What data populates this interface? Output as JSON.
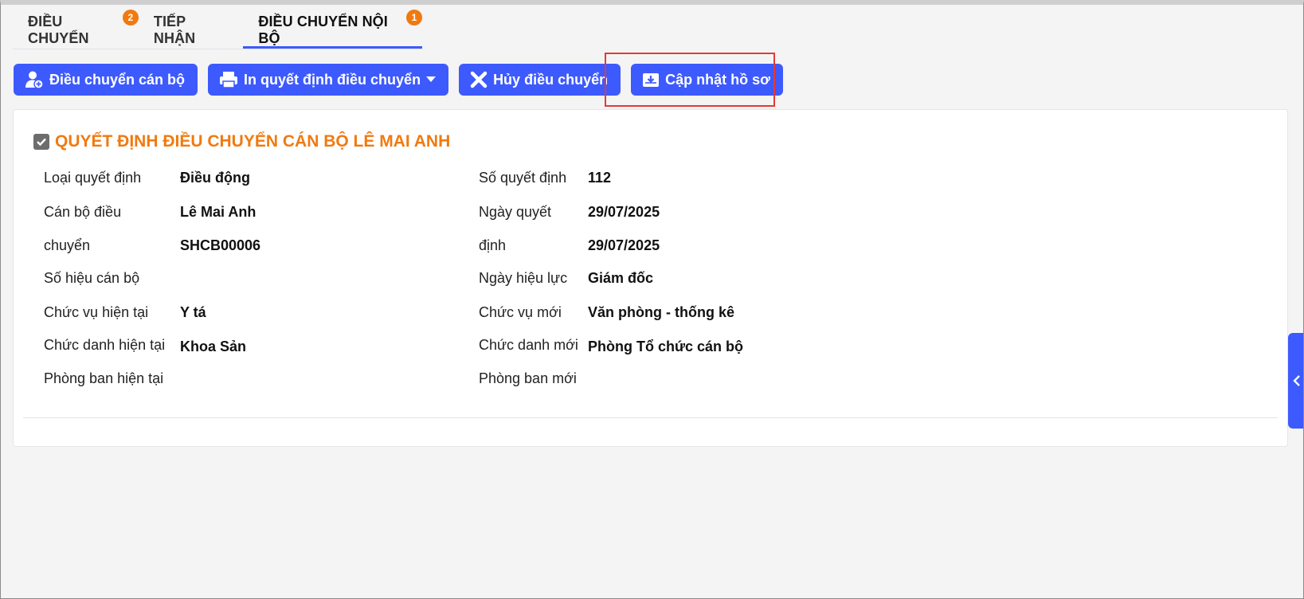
{
  "tabs": [
    {
      "label": "ĐIỀU CHUYỂN",
      "badge": "2"
    },
    {
      "label": "TIẾP NHẬN",
      "badge": ""
    },
    {
      "label": "ĐIỀU CHUYỂN NỘI BỘ",
      "badge": "1"
    }
  ],
  "toolbar": {
    "transfer_staff": "Điều chuyển cán bộ",
    "print_decision": "In quyết định điều chuyển",
    "cancel_transfer": "Hủy điều chuyển",
    "update_profile": "Cập nhật hồ sơ"
  },
  "decision": {
    "title": "QUYẾT ĐỊNH ĐIỀU CHUYỂN CÁN BỘ LÊ MAI ANH",
    "labels_left": {
      "decision_type": "Loại quyết định",
      "staff_line1": "Cán bộ điều",
      "staff_line2": "chuyển",
      "staff_code": "Số hiệu cán bộ",
      "current_position": "Chức vụ hiện tại",
      "current_title": "Chức danh hiện tại",
      "current_department": "Phòng ban hiện tại"
    },
    "values_left": {
      "decision_type": "Điều động",
      "staff": "Lê Mai Anh",
      "staff_code": "SHCB00006",
      "current_position": "Y tá",
      "current_title": "Khoa Sản"
    },
    "labels_right": {
      "decision_number": "Số quyết định",
      "decision_date_line1": "Ngày quyết",
      "decision_date_line2": "định",
      "effective_date": "Ngày hiệu lực",
      "new_position": "Chức vụ mới",
      "new_title": "Chức danh mới",
      "new_department": "Phòng ban mới"
    },
    "values_right": {
      "decision_number": "112",
      "decision_date": "29/07/2025",
      "effective_date": "29/07/2025",
      "new_position": "Giám đốc",
      "new_title": "Văn phòng - thống kê",
      "new_department": "Phòng Tổ chức cán bộ"
    }
  },
  "colors": {
    "primary": "#3d5afe",
    "accent_orange": "#f07a10",
    "highlight_red": "#e53935"
  }
}
